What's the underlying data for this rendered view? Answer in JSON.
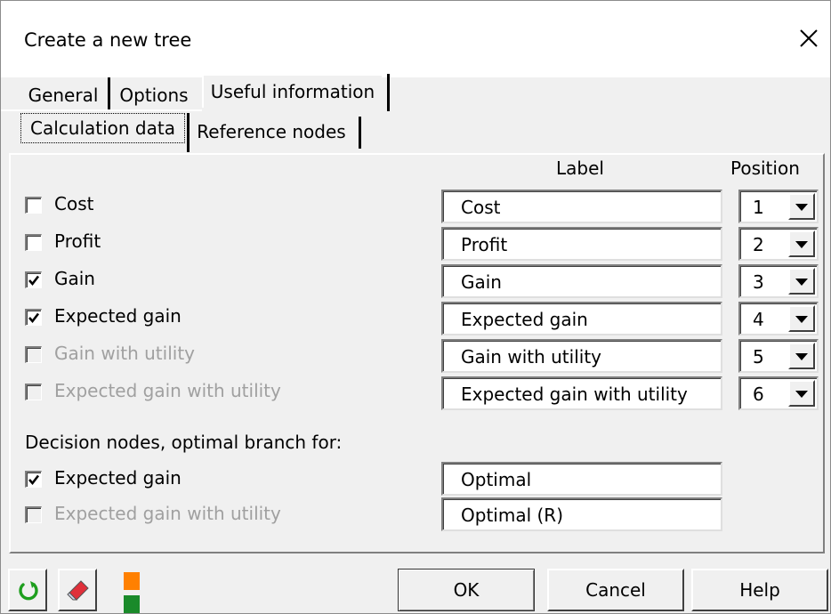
{
  "window": {
    "title": "Create a new tree",
    "close_icon": "close-icon"
  },
  "tabs": {
    "outer": [
      {
        "label": "General",
        "active": false
      },
      {
        "label": "Options",
        "active": false
      },
      {
        "label": "Useful information",
        "active": true
      }
    ],
    "inner": [
      {
        "label": "Calculation data",
        "active": true
      },
      {
        "label": "Reference nodes",
        "active": false
      }
    ]
  },
  "columns": {
    "label_header": "Label",
    "position_header": "Position"
  },
  "rows": [
    {
      "name": "Cost",
      "checked": false,
      "enabled": true,
      "label": "Cost",
      "position": "1"
    },
    {
      "name": "Profit",
      "checked": false,
      "enabled": true,
      "label": "Profit",
      "position": "2"
    },
    {
      "name": "Gain",
      "checked": true,
      "enabled": true,
      "label": "Gain",
      "position": "3"
    },
    {
      "name": "Expected gain",
      "checked": true,
      "enabled": true,
      "label": "Expected gain",
      "position": "4"
    },
    {
      "name": "Gain with utility",
      "checked": false,
      "enabled": false,
      "label": "Gain with utility",
      "position": "5"
    },
    {
      "name": "Expected gain with utility",
      "checked": false,
      "enabled": false,
      "label": "Expected gain with utility",
      "position": "6"
    }
  ],
  "decision": {
    "heading": "Decision nodes, optimal branch for:",
    "items": [
      {
        "name": "Expected gain",
        "checked": true,
        "enabled": true,
        "label": "Optimal"
      },
      {
        "name": "Expected gain with utility",
        "checked": false,
        "enabled": false,
        "label": "Optimal (R)"
      }
    ]
  },
  "footer": {
    "ok_label": "OK",
    "cancel_label": "Cancel",
    "help_label": "Help",
    "icons": [
      "refresh-icon",
      "eraser-icon",
      "color-swatch-icon"
    ]
  },
  "colors": {
    "refresh_green": "#1e9e1e",
    "swatch_orange": "#ff8000",
    "swatch_green": "#1a8a2a",
    "eraser_red": "#e0303a"
  }
}
